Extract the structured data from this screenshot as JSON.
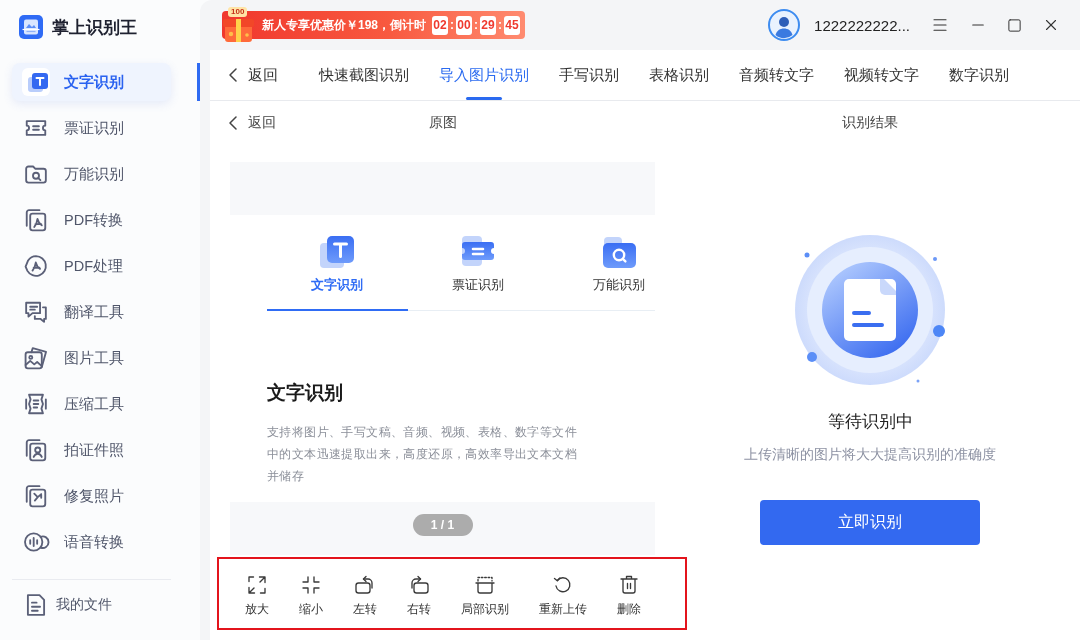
{
  "app": {
    "name": "掌上识别王"
  },
  "sidebar": {
    "items": [
      {
        "label": "文字识别",
        "selected": true
      },
      {
        "label": "票证识别",
        "selected": false
      },
      {
        "label": "万能识别",
        "selected": false
      },
      {
        "label": "PDF转换",
        "selected": false
      },
      {
        "label": "PDF处理",
        "selected": false
      },
      {
        "label": "翻译工具",
        "selected": false
      },
      {
        "label": "图片工具",
        "selected": false
      },
      {
        "label": "压缩工具",
        "selected": false
      },
      {
        "label": "拍证件照",
        "selected": false
      },
      {
        "label": "修复照片",
        "selected": false
      },
      {
        "label": "语音转换",
        "selected": false
      }
    ],
    "footer": {
      "label": "我的文件"
    }
  },
  "promo": {
    "gift_tag": "100",
    "text": "新人专享优惠价￥198，倒计时",
    "countdown": [
      {
        "kind": "digits",
        "text": "02"
      },
      {
        "kind": "separator",
        "text": ":"
      },
      {
        "kind": "digits",
        "text": "00"
      },
      {
        "kind": "separator",
        "text": ":"
      },
      {
        "kind": "digits",
        "text": "29"
      },
      {
        "kind": "separator",
        "text": ":"
      },
      {
        "kind": "digits",
        "text": "45"
      }
    ]
  },
  "account": {
    "username": "1222222222..."
  },
  "nav": {
    "back": "返回",
    "tabs": [
      {
        "label": "快速截图识别",
        "selected": false
      },
      {
        "label": "导入图片识别",
        "selected": true
      },
      {
        "label": "手写识别",
        "selected": false
      },
      {
        "label": "表格识别",
        "selected": false
      },
      {
        "label": "音频转文字",
        "selected": false
      },
      {
        "label": "视频转文字",
        "selected": false
      },
      {
        "label": "数字识别",
        "selected": false
      }
    ]
  },
  "source_panel": {
    "back": "返回",
    "title": "原图",
    "preview": {
      "tabs": [
        {
          "label": "文字识别",
          "selected": true
        },
        {
          "label": "票证识别",
          "selected": false
        },
        {
          "label": "万能识别",
          "selected": false
        }
      ],
      "heading": "文字识别",
      "description": "支持将图片、手写文稿、音频、视频、表格、数字等文件中的文本迅速提取出来，高度还原，高效率导出文本文档并储存",
      "page_indicator": "1 / 1"
    },
    "toolbar": {
      "highlighted": true,
      "items": [
        "放大",
        "缩小",
        "左转",
        "右转",
        "局部识别",
        "重新上传",
        "删除"
      ]
    }
  },
  "result_panel": {
    "title": "识别结果",
    "status": "等待识别中",
    "hint": "上传清晰的图片将大大提高识别的准确度",
    "button": "立即识别"
  }
}
